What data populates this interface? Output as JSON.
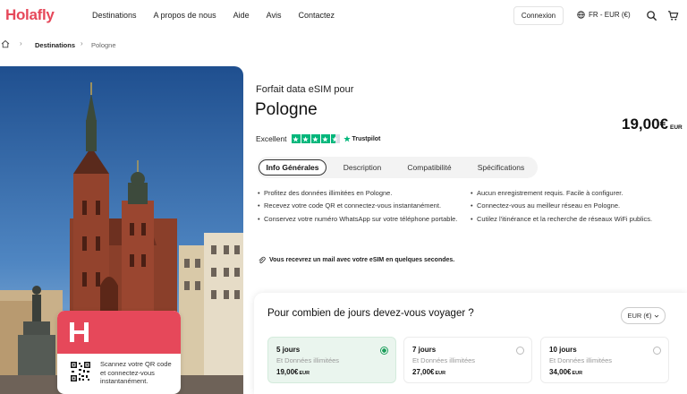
{
  "header": {
    "logo": "Holafly",
    "nav": [
      "Destinations",
      "A propos de nous",
      "Aide",
      "Avis",
      "Contactez"
    ],
    "login": "Connexion",
    "language": "FR - EUR (€)"
  },
  "breadcrumb": {
    "destinations": "Destinations",
    "current": "Pologne"
  },
  "product": {
    "subtitle": "Forfait data eSIM pour",
    "title": "Pologne",
    "price": "19,00€",
    "currency": "EUR",
    "rating_label": "Excellent",
    "rating_source": "Trustpilot"
  },
  "tabs": [
    "Info Générales",
    "Description",
    "Compatibilité",
    "Spécifications"
  ],
  "features_left": [
    "Profitez des données illimitées en Pologne.",
    "Recevez votre code QR et connectez-vous instantanément.",
    "Conservez votre numéro WhatsApp sur votre téléphone portable."
  ],
  "features_right": [
    "Aucun enregistrement requis. Facile à configurer.",
    "Connectez-vous au meilleur réseau en Pologne.",
    "Cutilez l'itinérance et la recherche de réseaux WiFi publics."
  ],
  "mail_note": "Vous recevrez un mail avec votre eSIM en quelques secondes.",
  "sim_card": {
    "text": "Scannez votre QR code et connectez-vous instantanément."
  },
  "days": {
    "question": "Pour combien de jours devez-vous voyager ?",
    "currency": "EUR (€)",
    "plans": [
      {
        "days": "5 jours",
        "data": "Et Données illimitées",
        "price": "19,00€",
        "currency": "EUR",
        "selected": true
      },
      {
        "days": "7 jours",
        "data": "Et Données illimitées",
        "price": "27,00€",
        "currency": "EUR",
        "selected": false
      },
      {
        "days": "10 jours",
        "data": "Et Données illimitées",
        "price": "34,00€",
        "currency": "EUR",
        "selected": false
      }
    ]
  },
  "colors": {
    "brand": "#e6485a",
    "trustpilot": "#00b67a",
    "selected_plan_bg": "#eaf5ee"
  }
}
